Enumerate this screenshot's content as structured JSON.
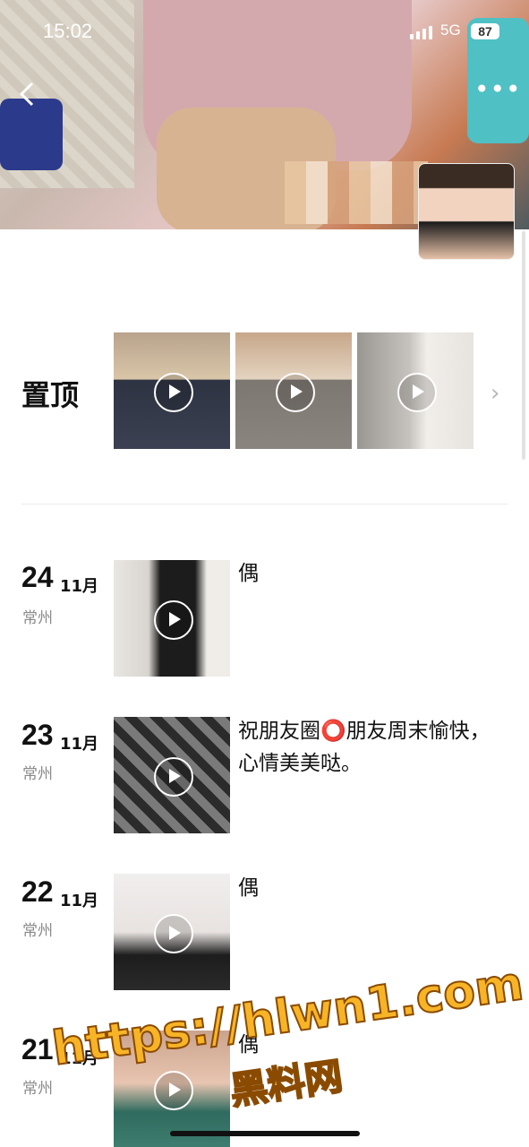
{
  "status_bar": {
    "time": "15:02",
    "network": "5G",
    "battery": "87"
  },
  "nav": {
    "back_icon": "chevron-left-icon",
    "more_icon": "more-dots-icon",
    "more_label": "•••"
  },
  "pinned": {
    "label": "置顶",
    "chevron_icon": "chevron-right-icon",
    "chevron_label": "›"
  },
  "posts": [
    {
      "day": "24",
      "month": "11月",
      "location": "常州",
      "caption": "偶"
    },
    {
      "day": "23",
      "month": "11月",
      "location": "常州",
      "caption": "祝朋友圈⭕朋友周末愉快，心情美美哒。"
    },
    {
      "day": "22",
      "month": "11月",
      "location": "常州",
      "caption": "偶"
    },
    {
      "day": "21",
      "month": "11月",
      "location": "常州",
      "caption": "偶"
    }
  ],
  "watermark": {
    "url": "https://hlwn1.com",
    "brand": "黑料网"
  },
  "colors": {
    "watermark": "#f7b427",
    "secondary_text": "#8a8a8a"
  }
}
